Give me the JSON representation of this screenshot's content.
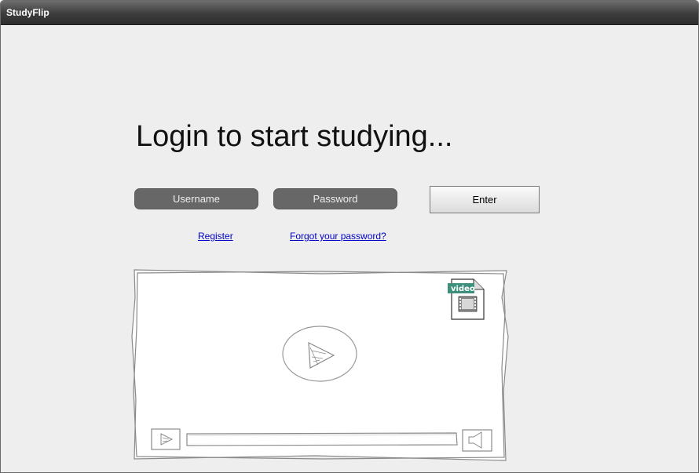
{
  "window": {
    "title": "StudyFlip"
  },
  "login": {
    "heading": "Login to start studying...",
    "username_placeholder": "Username",
    "password_placeholder": "Password",
    "enter_label": "Enter",
    "register_label": "Register",
    "forgot_label": "Forgot your password?"
  },
  "video": {
    "badge_label": "video",
    "icons": [
      "video-file-icon",
      "play-icon",
      "volume-icon"
    ]
  }
}
